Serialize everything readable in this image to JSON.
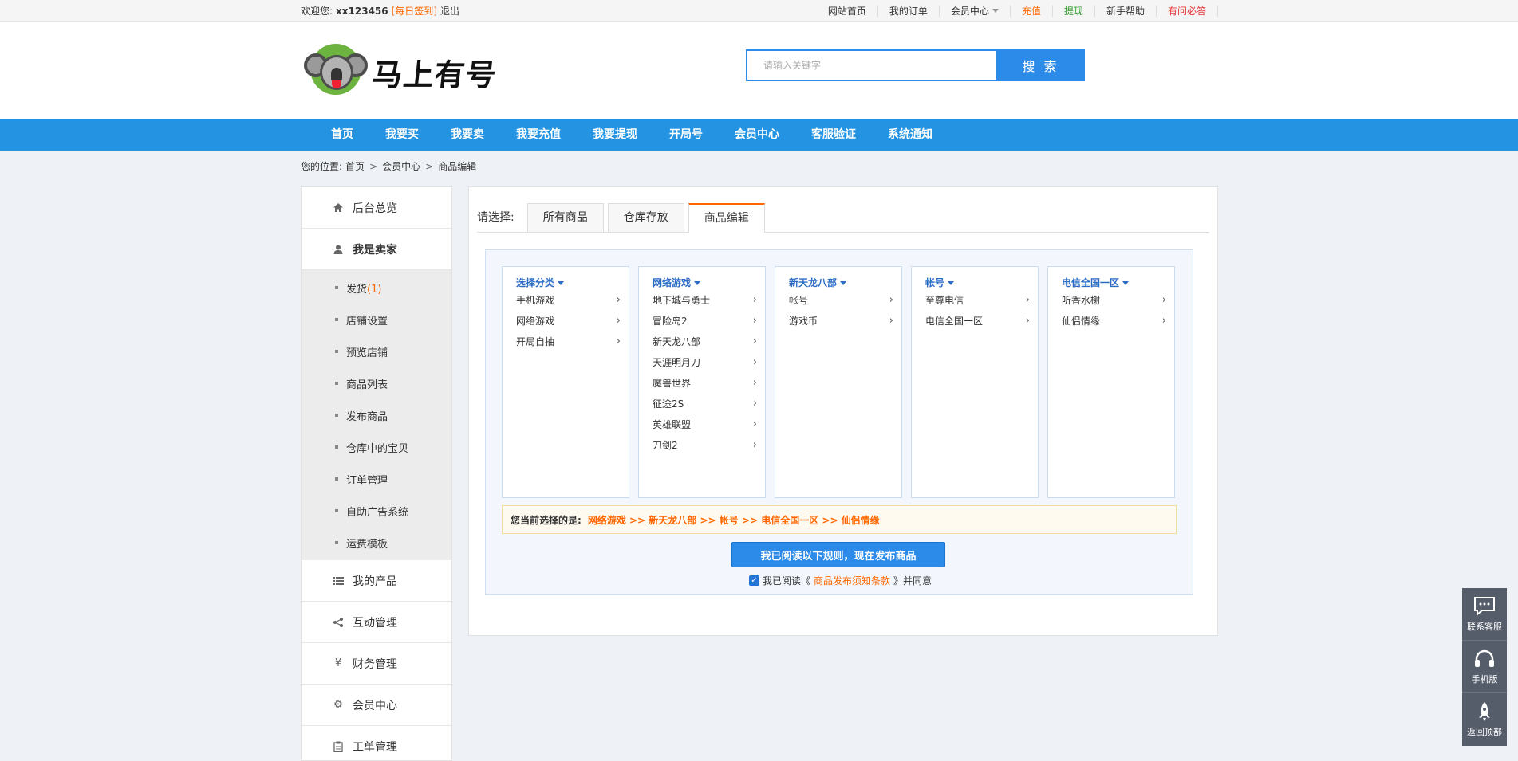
{
  "topbar": {
    "welcome_prefix": "欢迎您:",
    "username": "xx123456",
    "daily_sign": "[每日签到]",
    "logout": "退出",
    "links": [
      {
        "label": "网站首页",
        "color": "#333333"
      },
      {
        "label": "我的订单",
        "color": "#333333"
      },
      {
        "label": "会员中心",
        "color": "#333333",
        "dropdown": true
      },
      {
        "label": "充值",
        "color": "#ff6600"
      },
      {
        "label": "提现",
        "color": "#2e9e2e"
      },
      {
        "label": "新手帮助",
        "color": "#333333"
      },
      {
        "label": "有问必答",
        "color": "#e4393c"
      }
    ]
  },
  "header": {
    "logo_text": "马上有号",
    "search_placeholder": "请输入关键字",
    "search_button": "搜 索"
  },
  "nav": [
    "首页",
    "我要买",
    "我要卖",
    "我要充值",
    "我要提现",
    "开局号",
    "会员中心",
    "客服验证",
    "系统通知"
  ],
  "breadcrumb": {
    "prefix": "您的位置:",
    "items": [
      "首页",
      "会员中心",
      "商品编辑"
    ],
    "separator": ">"
  },
  "sidebar": {
    "overview": "后台总览",
    "seller": "我是卖家",
    "seller_items": [
      {
        "label": "发货",
        "badge": "(1)"
      },
      {
        "label": "店铺设置"
      },
      {
        "label": "预览店铺"
      },
      {
        "label": "商品列表"
      },
      {
        "label": "发布商品"
      },
      {
        "label": "仓库中的宝贝"
      },
      {
        "label": "订单管理"
      },
      {
        "label": "自助广告系统"
      },
      {
        "label": "运费模板"
      }
    ],
    "sections": [
      {
        "label": "我的产品",
        "icon": "list-icon"
      },
      {
        "label": "互动管理",
        "icon": "share-icon"
      },
      {
        "label": "财务管理",
        "icon": "yen-icon"
      },
      {
        "label": "会员中心",
        "icon": "gears-icon"
      },
      {
        "label": "工单管理",
        "icon": "clipboard-icon"
      }
    ]
  },
  "tabs": {
    "label": "请选择:",
    "items": [
      "所有商品",
      "仓库存放",
      "商品编辑"
    ],
    "active": "商品编辑"
  },
  "picker": {
    "columns": [
      {
        "header": "选择分类",
        "options": [
          "手机游戏",
          "网络游戏",
          "开局自抽"
        ]
      },
      {
        "header": "网络游戏",
        "options": [
          "地下城与勇士",
          "冒险岛2",
          "新天龙八部",
          "天涯明月刀",
          "魔兽世界",
          "征途2S",
          "英雄联盟",
          "刀剑2"
        ]
      },
      {
        "header": "新天龙八部",
        "options": [
          "帐号",
          "游戏币"
        ]
      },
      {
        "header": "帐号",
        "options": [
          "至尊电信",
          "电信全国一区"
        ]
      },
      {
        "header": "电信全国一区",
        "options": [
          "听香水榭",
          "仙侣情缘"
        ]
      }
    ],
    "selected_label": "您当前选择的是:",
    "selected_path": "网络游戏 >> 新天龙八部 >> 帐号 >> 电信全国一区 >> 仙侣情缘",
    "publish_button": "我已阅读以下规则，现在发布商品",
    "agree_prefix": "我已阅读《",
    "agree_link": "商品发布须知条款",
    "agree_suffix": "》并同意",
    "agree_checked": true
  },
  "float_bar": [
    {
      "label": "联系客服",
      "icon": "chat-icon"
    },
    {
      "label": "手机版",
      "icon": "headset-icon"
    },
    {
      "label": "返回顶部",
      "icon": "rocket-icon"
    }
  ],
  "colors": {
    "primary": "#2c8be8",
    "nav": "#2494e2",
    "accent": "#ff6600"
  }
}
